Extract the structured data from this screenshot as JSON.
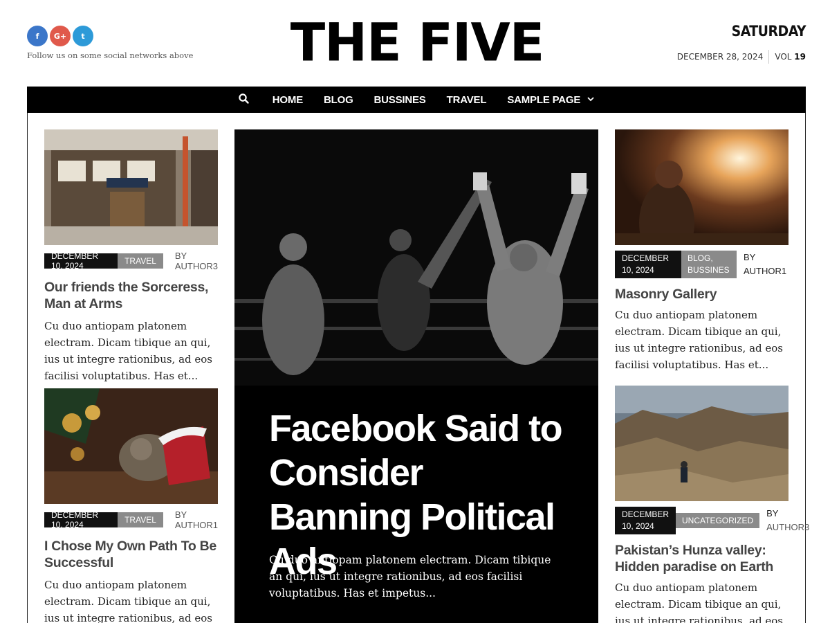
{
  "header": {
    "social": [
      {
        "icon": "facebook-icon",
        "glyph": "f",
        "color": "#3b76c9"
      },
      {
        "icon": "google-plus-icon",
        "glyph": "G+",
        "color": "#e0594b"
      },
      {
        "icon": "twitter-icon",
        "glyph": "t",
        "color": "#2d9ad8"
      }
    ],
    "follow_text": "Follow us on some social networks above",
    "logo": "THE FIVE",
    "day": "SATURDAY",
    "date": "DECEMBER 28, 2024",
    "vol_label": "VOL",
    "vol_number": "19"
  },
  "nav": {
    "search_icon": "search-icon",
    "items": [
      "HOME",
      "BLOG",
      "BUSSINES",
      "TRAVEL",
      "SAMPLE PAGE"
    ],
    "dropdown_icon": "chevron-down-icon"
  },
  "left": [
    {
      "date": "DECEMBER 10, 2024",
      "category": "TRAVEL",
      "by": "BY",
      "author": "AUTHOR3",
      "title": "Our friends the Sorceress, Man at Arms",
      "excerpt": "Cu duo antiopam platonem electram. Dicam tibique an qui, ius ut integre rationibus, ad eos facilisi voluptatibus. Has et..."
    },
    {
      "date": "DECEMBER 10, 2024",
      "category": "TRAVEL",
      "by": "BY",
      "author": "AUTHOR1",
      "title": "I Chose My Own Path To Be Successful",
      "excerpt": "Cu duo antiopam platonem electram. Dicam tibique an qui, ius ut integre rationibus, ad eos"
    }
  ],
  "hero": {
    "title": "Facebook Said to Consider Banning Political Ads",
    "excerpt": "Cu duo antiopam platonem electram. Dicam tibique an qui, ius ut integre rationibus, ad eos facilisi voluptatibus. Has et impetus..."
  },
  "right": [
    {
      "date": "DECEMBER 10, 2024",
      "category": "BLOG, BUSSINES",
      "by": "BY",
      "author": "AUTHOR1",
      "title": "Masonry Gallery",
      "excerpt": "Cu duo antiopam platonem electram. Dicam tibique an qui, ius ut integre rationibus, ad eos facilisi voluptatibus. Has et..."
    },
    {
      "date": "DECEMBER 10, 2024",
      "category": "UNCATEGORIZED",
      "by": "BY",
      "author": "AUTHOR3",
      "title": "Pakistan’s Hunza valley: Hidden paradise on Earth",
      "excerpt": "Cu duo antiopam platonem electram. Dicam tibique an qui, ius ut integre rationibus, ad eos"
    }
  ]
}
